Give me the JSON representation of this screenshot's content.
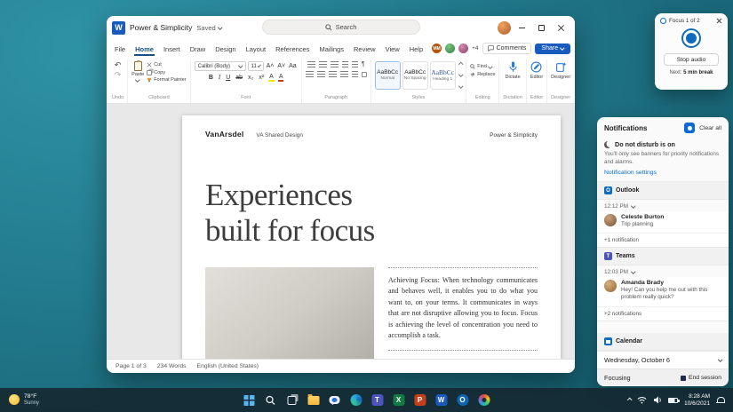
{
  "colors": {
    "word_blue": "#185abd",
    "accent_blue": "#0b6bd3",
    "wallpaper_teal": "#227a8d",
    "taskbar_dark": "#152a34"
  },
  "icons": {
    "undo": "↶",
    "redo": "↷",
    "pilcrow": "¶",
    "increase_font": "A˄",
    "decrease_font": "A˅",
    "change_case": "Aa"
  },
  "word": {
    "titlebar": {
      "title": "Power & Simplicity",
      "saved": "Saved",
      "search": "Search"
    },
    "tabs": [
      "File",
      "Home",
      "Insert",
      "Draw",
      "Design",
      "Layout",
      "References",
      "Mailings",
      "Review",
      "View",
      "Help"
    ],
    "collab": {
      "avatar_initials": "MM",
      "overflow": "+4",
      "comments": "Comments",
      "share": "Share"
    },
    "ribbon": {
      "group_labels": [
        "Undo",
        "Clipboard",
        "Font",
        "Paragraph",
        "Styles",
        "Editing",
        "Dictation",
        "Editor",
        "Designer"
      ],
      "clipboard": {
        "paste": "Paste",
        "cut": "Cut",
        "copy": "Copy",
        "format_painter": "Format Painter"
      },
      "font": {
        "family": "Calibri (Body)",
        "size": "11",
        "format": [
          "B",
          "I",
          "U",
          "ab",
          "x₂",
          "x²",
          "A",
          "A"
        ]
      },
      "styles": [
        {
          "preview": "AaBbCc",
          "name": "Normal"
        },
        {
          "preview": "AaBbCc",
          "name": "No Spacing"
        },
        {
          "preview": "AaBbCc",
          "name": "Heading 1"
        }
      ],
      "editing": {
        "find": "Find",
        "replace": "Replace"
      },
      "dictate": "Dictate",
      "editor": "Editor",
      "designer": "Designer"
    },
    "document": {
      "brand": "VanArsdel",
      "subtitle": "VA Shared Design",
      "header_right": "Power & Simplicity",
      "heading1": "Experiences",
      "heading2": "built for focus",
      "paragraph": "Achieving Focus: When technology communicates and behaves well, it enables you to do what you want to, on your terms. It communicates in ways that are not disruptive allowing you to focus. Focus is achieving the level of concentration you need to accomplish a task."
    },
    "status": {
      "page": "Page 1 of 3",
      "words": "234 Words",
      "language": "English (United States)"
    }
  },
  "focus_widget": {
    "title": "Focus 1 of 2",
    "stop": "Stop audio",
    "next_label": "Next:",
    "next_value": "5 min break"
  },
  "notifications": {
    "title": "Notifications",
    "clear_all": "Clear all",
    "dnd_title": "Do not disturb is on",
    "dnd_body": "You'll only see banners for priority notifications and alarms.",
    "settings_link": "Notification settings",
    "groups": [
      {
        "app": "Outlook",
        "time": "12:12 PM",
        "sender": "Celeste Burton",
        "message": "Trip planning",
        "more": "+1 notification"
      },
      {
        "app": "Teams",
        "time": "12:03 PM",
        "sender": "Amanda Brady",
        "message": "Hey! Can you help me out with this problem really quick?",
        "more": "+2 notifications"
      }
    ],
    "calendar": "Calendar",
    "date_row": "Wednesday, October 6",
    "focus_status": "Focusing",
    "end_session": "End session"
  },
  "taskbar": {
    "weather": {
      "temp": "78°F",
      "desc": "Sunny"
    },
    "apps": [
      {
        "name": "start",
        "glyph": ""
      },
      {
        "name": "search",
        "glyph": ""
      },
      {
        "name": "task-view",
        "glyph": ""
      },
      {
        "name": "file-explorer",
        "glyph": ""
      },
      {
        "name": "chat",
        "glyph": ""
      },
      {
        "name": "edge",
        "glyph": ""
      },
      {
        "name": "teams",
        "glyph": "T"
      },
      {
        "name": "excel",
        "glyph": "X"
      },
      {
        "name": "powerpoint",
        "glyph": "P"
      },
      {
        "name": "word",
        "glyph": "W"
      },
      {
        "name": "outlook",
        "glyph": "O"
      },
      {
        "name": "photos",
        "glyph": ""
      }
    ],
    "clock": {
      "time": "8:28 AM",
      "date": "10/6/2021"
    }
  }
}
